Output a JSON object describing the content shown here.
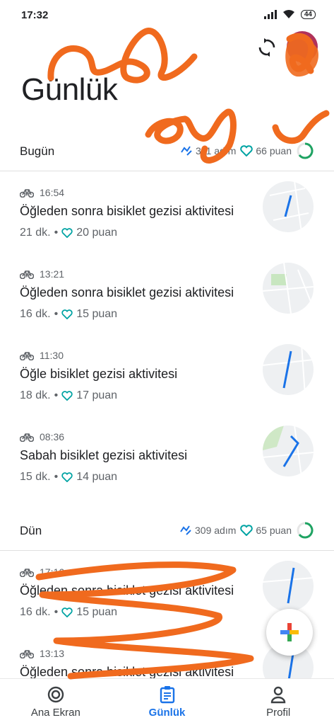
{
  "status_bar": {
    "time": "17:32",
    "battery": "44"
  },
  "header": {
    "title": "Günlük"
  },
  "days": [
    {
      "label": "Bugün",
      "steps": "311 adım",
      "points": "66 puan",
      "activities": [
        {
          "time": "16:54",
          "title": "Öğleden sonra bisiklet gezisi aktivitesi",
          "duration": "21 dk.",
          "points": "20 puan"
        },
        {
          "time": "13:21",
          "title": "Öğleden sonra bisiklet gezisi aktivitesi",
          "duration": "16 dk.",
          "points": "15 puan"
        },
        {
          "time": "11:30",
          "title": "Öğle bisiklet gezisi aktivitesi",
          "duration": "18 dk.",
          "points": "17 puan"
        },
        {
          "time": "08:36",
          "title": "Sabah bisiklet gezisi aktivitesi",
          "duration": "15 dk.",
          "points": "14 puan"
        }
      ]
    },
    {
      "label": "Dün",
      "steps": "309 adım",
      "points": "65 puan",
      "activities": [
        {
          "time": "17:16",
          "title": "Öğleden sonra bisiklet gezisi aktivitesi",
          "duration": "16 dk.",
          "points": "15 puan"
        },
        {
          "time": "13:13",
          "title": "Öğleden sonra bisiklet gezisi aktivitesi",
          "duration": "",
          "points": ""
        }
      ]
    }
  ],
  "nav": {
    "items": [
      {
        "label": "Ana Ekran",
        "icon": "home-ring-icon"
      },
      {
        "label": "Günlük",
        "icon": "journal-icon"
      },
      {
        "label": "Profil",
        "icon": "person-icon"
      }
    ],
    "active": "Günlük"
  },
  "colors": {
    "accent": "#1a73e8",
    "heart": "#00a3a3",
    "ring": "#1ea362",
    "scribble": "#f06a1e"
  }
}
